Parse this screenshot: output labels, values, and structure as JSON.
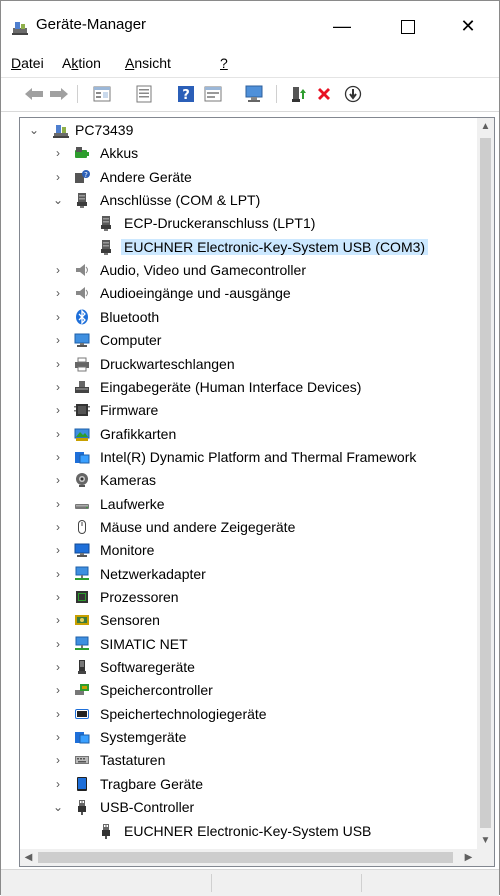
{
  "window": {
    "title": "Geräte-Manager",
    "minimize_glyph": "—",
    "close_glyph": "✕"
  },
  "menu": {
    "items": [
      {
        "label": "Datei"
      },
      {
        "label": "Aktion"
      },
      {
        "label": "Ansicht"
      },
      {
        "label": "?"
      }
    ]
  },
  "toolbar": {
    "buttons": [
      "back-icon",
      "forward-icon",
      "properties-view-icon",
      "device-properties-icon",
      "help-icon",
      "show-hidden-icon",
      "scan-hardware-icon",
      "update-driver-icon",
      "uninstall-icon",
      "disable-device-icon"
    ]
  },
  "tree": {
    "root": {
      "label": "PC73439",
      "expanded": true
    },
    "items": [
      {
        "label": "Akkus",
        "level": 1,
        "expanded": false,
        "icon": "battery-icon"
      },
      {
        "label": "Andere Geräte",
        "level": 1,
        "expanded": false,
        "icon": "unknown-device-icon"
      },
      {
        "label": "Anschlüsse (COM & LPT)",
        "level": 1,
        "expanded": true,
        "icon": "port-icon"
      },
      {
        "label": "ECP-Druckeranschluss (LPT1)",
        "level": 2,
        "icon": "port-icon"
      },
      {
        "label": "EUCHNER Electronic-Key-System USB (COM3)",
        "level": 2,
        "icon": "port-icon",
        "selected": true
      },
      {
        "label": "Audio, Video und Gamecontroller",
        "level": 1,
        "expanded": false,
        "icon": "speaker-icon"
      },
      {
        "label": "Audioeingänge und -ausgänge",
        "level": 1,
        "expanded": false,
        "icon": "speaker-icon"
      },
      {
        "label": "Bluetooth",
        "level": 1,
        "expanded": false,
        "icon": "bluetooth-icon"
      },
      {
        "label": "Computer",
        "level": 1,
        "expanded": false,
        "icon": "computer-icon"
      },
      {
        "label": "Druckwarteschlangen",
        "level": 1,
        "expanded": false,
        "icon": "printer-icon"
      },
      {
        "label": "Eingabegeräte (Human Interface Devices)",
        "level": 1,
        "expanded": false,
        "icon": "hid-icon"
      },
      {
        "label": "Firmware",
        "level": 1,
        "expanded": false,
        "icon": "firmware-icon"
      },
      {
        "label": "Grafikkarten",
        "level": 1,
        "expanded": false,
        "icon": "display-adapter-icon"
      },
      {
        "label": "Intel(R) Dynamic Platform and Thermal Framework",
        "level": 1,
        "expanded": false,
        "icon": "system-device-icon"
      },
      {
        "label": "Kameras",
        "level": 1,
        "expanded": false,
        "icon": "camera-icon"
      },
      {
        "label": "Laufwerke",
        "level": 1,
        "expanded": false,
        "icon": "disk-drive-icon"
      },
      {
        "label": "Mäuse und andere Zeigegeräte",
        "level": 1,
        "expanded": false,
        "icon": "mouse-icon"
      },
      {
        "label": "Monitore",
        "level": 1,
        "expanded": false,
        "icon": "monitor-icon"
      },
      {
        "label": "Netzwerkadapter",
        "level": 1,
        "expanded": false,
        "icon": "network-adapter-icon"
      },
      {
        "label": "Prozessoren",
        "level": 1,
        "expanded": false,
        "icon": "processor-icon"
      },
      {
        "label": "Sensoren",
        "level": 1,
        "expanded": false,
        "icon": "sensor-icon"
      },
      {
        "label": "SIMATIC NET",
        "level": 1,
        "expanded": false,
        "icon": "network-adapter-icon"
      },
      {
        "label": "Softwaregeräte",
        "level": 1,
        "expanded": false,
        "icon": "software-device-icon"
      },
      {
        "label": "Speichercontroller",
        "level": 1,
        "expanded": false,
        "icon": "storage-controller-icon"
      },
      {
        "label": "Speichertechnologiegeräte",
        "level": 1,
        "expanded": false,
        "icon": "memory-tech-icon"
      },
      {
        "label": "Systemgeräte",
        "level": 1,
        "expanded": false,
        "icon": "system-device-icon"
      },
      {
        "label": "Tastaturen",
        "level": 1,
        "expanded": false,
        "icon": "keyboard-icon"
      },
      {
        "label": "Tragbare Geräte",
        "level": 1,
        "expanded": false,
        "icon": "portable-device-icon"
      },
      {
        "label": "USB-Controller",
        "level": 1,
        "expanded": true,
        "icon": "usb-icon"
      },
      {
        "label": "EUCHNER Electronic-Key-System USB",
        "level": 2,
        "icon": "usb-icon"
      }
    ]
  },
  "colors": {
    "selection": "#cce8ff",
    "accent_blue": "#1e6fd9",
    "delete_red": "#e81123",
    "driver_green": "#2e9d2e"
  }
}
